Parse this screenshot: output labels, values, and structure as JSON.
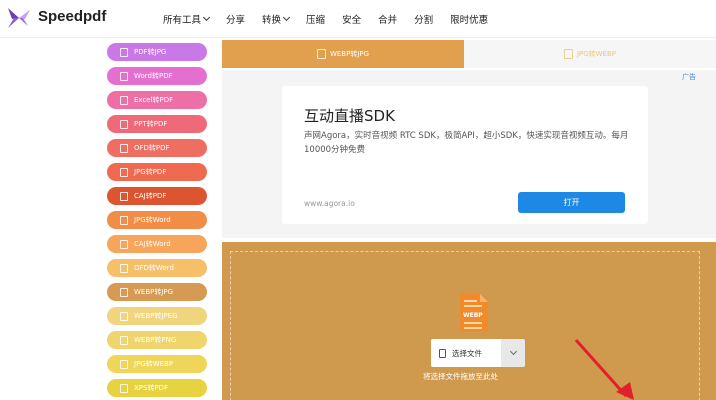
{
  "brand": {
    "name": "Speedpdf",
    "logo_icon": "butterfly-logo-icon",
    "logo_color": "#6a3fb0"
  },
  "nav": {
    "items": [
      {
        "label": "所有工具",
        "has_dropdown": true
      },
      {
        "label": "分享",
        "has_dropdown": false
      },
      {
        "label": "转换",
        "has_dropdown": true
      },
      {
        "label": "压缩",
        "has_dropdown": false
      },
      {
        "label": "安全",
        "has_dropdown": false
      },
      {
        "label": "合并",
        "has_dropdown": false
      },
      {
        "label": "分割",
        "has_dropdown": false
      },
      {
        "label": "限时优惠",
        "has_dropdown": false
      }
    ]
  },
  "sidebar": {
    "items": [
      {
        "label": "PDF转JPG",
        "color": "#c978e8"
      },
      {
        "label": "Word转PDF",
        "color": "#e56fcf"
      },
      {
        "label": "Excel转PDF",
        "color": "#ee6ea6"
      },
      {
        "label": "PPT转PDF",
        "color": "#ee6a78"
      },
      {
        "label": "OFD转PDF",
        "color": "#ef6e62"
      },
      {
        "label": "JPG转PDF",
        "color": "#ef6a50"
      },
      {
        "label": "CAJ转PDF",
        "color": "#dd5530"
      },
      {
        "label": "JPG转Word",
        "color": "#f28d48"
      },
      {
        "label": "CAJ转Word",
        "color": "#f6a55a"
      },
      {
        "label": "OFD转Word",
        "color": "#f6bf6a"
      },
      {
        "label": "WEBP转JPG",
        "color": "#d69a52"
      },
      {
        "label": "WEBP转JPEG",
        "color": "#f1d57e"
      },
      {
        "label": "WEBP转PNG",
        "color": "#f0d56c"
      },
      {
        "label": "JPG转WEBP",
        "color": "#efd65b"
      },
      {
        "label": "XPS转PDF",
        "color": "#e7d341"
      }
    ]
  },
  "tabs": {
    "active": {
      "label": "WEBP转JPG"
    },
    "inactive": {
      "label": "JPG转WEBP"
    }
  },
  "ad": {
    "tag": "广告",
    "title": "互动直播SDK",
    "description": "声网Agora，实时音视频 RTC SDK，极简API，超小SDK，快速实现音视频互动。每月10000分钟免费",
    "url": "www.agora.io",
    "button_label": "打开"
  },
  "upload": {
    "file_icon_label": "WEBP",
    "select_label": "选择文件",
    "drop_hint": "将选择文件拖放至此处"
  }
}
